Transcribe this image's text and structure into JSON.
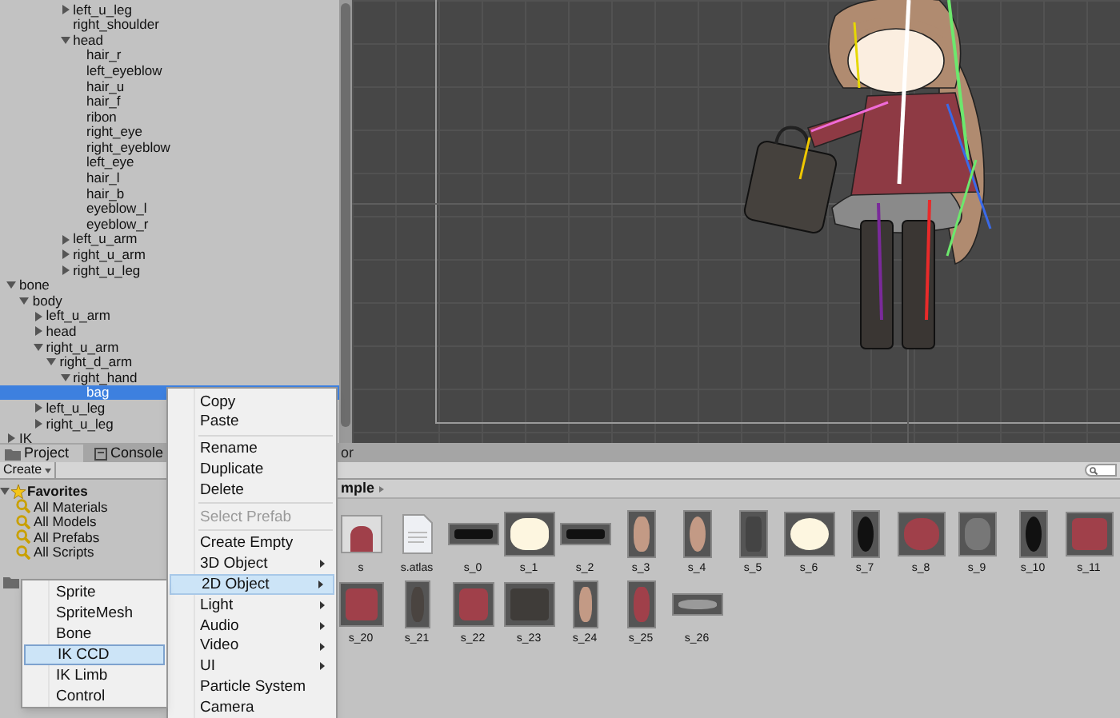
{
  "hierarchy": {
    "rows_above": [
      {
        "label": "left_u_leg",
        "expanded": false,
        "selected": false
      },
      {
        "label": "right_shoulder",
        "selected": false
      },
      {
        "label": "head",
        "expanded": true,
        "selected": false,
        "children": [
          {
            "label": "hair_r",
            "selected": false
          },
          {
            "label": "left_eyeblow",
            "selected": false
          },
          {
            "label": "hair_u",
            "selected": false
          },
          {
            "label": "hair_f",
            "selected": false
          },
          {
            "label": "ribon",
            "selected": false
          },
          {
            "label": "right_eye",
            "selected": false
          },
          {
            "label": "right_eyeblow",
            "selected": false
          },
          {
            "label": "left_eye",
            "selected": false
          },
          {
            "label": "hair_l",
            "selected": false
          },
          {
            "label": "hair_b",
            "selected": false
          },
          {
            "label": "eyeblow_l",
            "selected": false
          },
          {
            "label": "eyeblow_r",
            "selected": false
          }
        ]
      },
      {
        "label": "left_u_arm",
        "expanded": false,
        "selected": false
      },
      {
        "label": "right_u_arm",
        "expanded": false,
        "selected": false
      },
      {
        "label": "right_u_leg",
        "expanded": false,
        "selected": false
      }
    ],
    "items": [
      {
        "label": "bone",
        "expanded": true,
        "selected": false,
        "children": [
          {
            "label": "body",
            "expanded": true,
            "selected": false,
            "children": [
              {
                "label": "left_u_arm",
                "expanded": false,
                "selected": false
              },
              {
                "label": "head",
                "expanded": false,
                "selected": false
              },
              {
                "label": "right_u_arm",
                "expanded": true,
                "selected": false,
                "children": [
                  {
                    "label": "right_d_arm",
                    "expanded": true,
                    "selected": false,
                    "children": [
                      {
                        "label": "right_hand",
                        "expanded": true,
                        "selected": false,
                        "children": [
                          {
                            "label": "bag",
                            "selected": true
                          }
                        ]
                      }
                    ]
                  }
                ]
              },
              {
                "label": "left_u_leg",
                "expanded": false,
                "selected": false
              },
              {
                "label": "right_u_leg",
                "expanded": false,
                "selected": false
              }
            ]
          }
        ]
      },
      {
        "label": "IK",
        "expanded": false,
        "selected": false
      }
    ]
  },
  "project": {
    "tabs": [
      {
        "label": "Project",
        "selected": true
      },
      {
        "label": "Console",
        "selected": false
      }
    ],
    "create_button": "Create",
    "favorites": {
      "label": "Favorites",
      "expanded": true,
      "children": [
        {
          "label": "All Materials"
        },
        {
          "label": "All Models"
        },
        {
          "label": "All Prefabs"
        },
        {
          "label": "All Scripts"
        }
      ]
    }
  },
  "assets_panel": {
    "tab_label": "or",
    "breadcrumb": "mple",
    "asset_rows": [
      [
        {
          "name": "s",
          "kind": "prefab"
        },
        {
          "name": "s.atlas",
          "kind": "atlas"
        },
        {
          "name": "s_0",
          "kind": "sprite"
        },
        {
          "name": "s_1",
          "kind": "sprite"
        },
        {
          "name": "s_2",
          "kind": "sprite"
        },
        {
          "name": "s_3",
          "kind": "sprite"
        },
        {
          "name": "s_4",
          "kind": "sprite"
        },
        {
          "name": "s_5",
          "kind": "sprite"
        },
        {
          "name": "s_6",
          "kind": "sprite"
        },
        {
          "name": "s_7",
          "kind": "sprite"
        },
        {
          "name": "s_8",
          "kind": "sprite"
        },
        {
          "name": "s_9",
          "kind": "sprite"
        },
        {
          "name": "s_10",
          "kind": "sprite"
        },
        {
          "name": "s_11",
          "kind": "sprite"
        }
      ],
      [
        {
          "name": "s_20",
          "kind": "sprite"
        },
        {
          "name": "s_21",
          "kind": "sprite"
        },
        {
          "name": "s_22",
          "kind": "sprite"
        },
        {
          "name": "s_23",
          "kind": "sprite"
        },
        {
          "name": "s_24",
          "kind": "sprite"
        },
        {
          "name": "s_25",
          "kind": "sprite"
        },
        {
          "name": "s_26",
          "kind": "sprite"
        }
      ]
    ]
  },
  "context_menu": {
    "items": [
      {
        "kind": "item",
        "label": "Copy",
        "disabled": false,
        "selected": false
      },
      {
        "kind": "item",
        "label": "Paste",
        "disabled": false,
        "selected": false
      },
      {
        "kind": "separator"
      },
      {
        "kind": "item",
        "label": "Rename",
        "disabled": false,
        "selected": false
      },
      {
        "kind": "item",
        "label": "Duplicate",
        "disabled": false,
        "selected": false
      },
      {
        "kind": "item",
        "label": "Delete",
        "disabled": false,
        "selected": false
      },
      {
        "kind": "separator"
      },
      {
        "kind": "item",
        "label": "Select Prefab",
        "disabled": true,
        "selected": false
      },
      {
        "kind": "separator"
      },
      {
        "kind": "item",
        "label": "Create Empty",
        "disabled": false,
        "selected": false
      },
      {
        "kind": "submenu",
        "label": "3D Object",
        "disabled": false,
        "selected": false
      },
      {
        "kind": "submenu",
        "label": "2D Object",
        "disabled": false,
        "selected": true
      },
      {
        "kind": "submenu",
        "label": "Light",
        "disabled": false,
        "selected": false
      },
      {
        "kind": "submenu",
        "label": "Audio",
        "disabled": false,
        "selected": false
      },
      {
        "kind": "submenu",
        "label": "Video",
        "disabled": false,
        "selected": false
      },
      {
        "kind": "submenu",
        "label": "UI",
        "disabled": false,
        "selected": false
      },
      {
        "kind": "item",
        "label": "Particle System",
        "disabled": false,
        "selected": false
      },
      {
        "kind": "item",
        "label": "Camera",
        "disabled": false,
        "selected": false
      }
    ]
  },
  "submenu": {
    "items": [
      {
        "label": "Sprite",
        "selected": false
      },
      {
        "label": "SpriteMesh",
        "selected": false
      },
      {
        "label": "Bone",
        "selected": false
      },
      {
        "label": "IK CCD",
        "selected": true
      },
      {
        "label": "IK Limb",
        "selected": false
      },
      {
        "label": "Control",
        "selected": false
      }
    ]
  }
}
